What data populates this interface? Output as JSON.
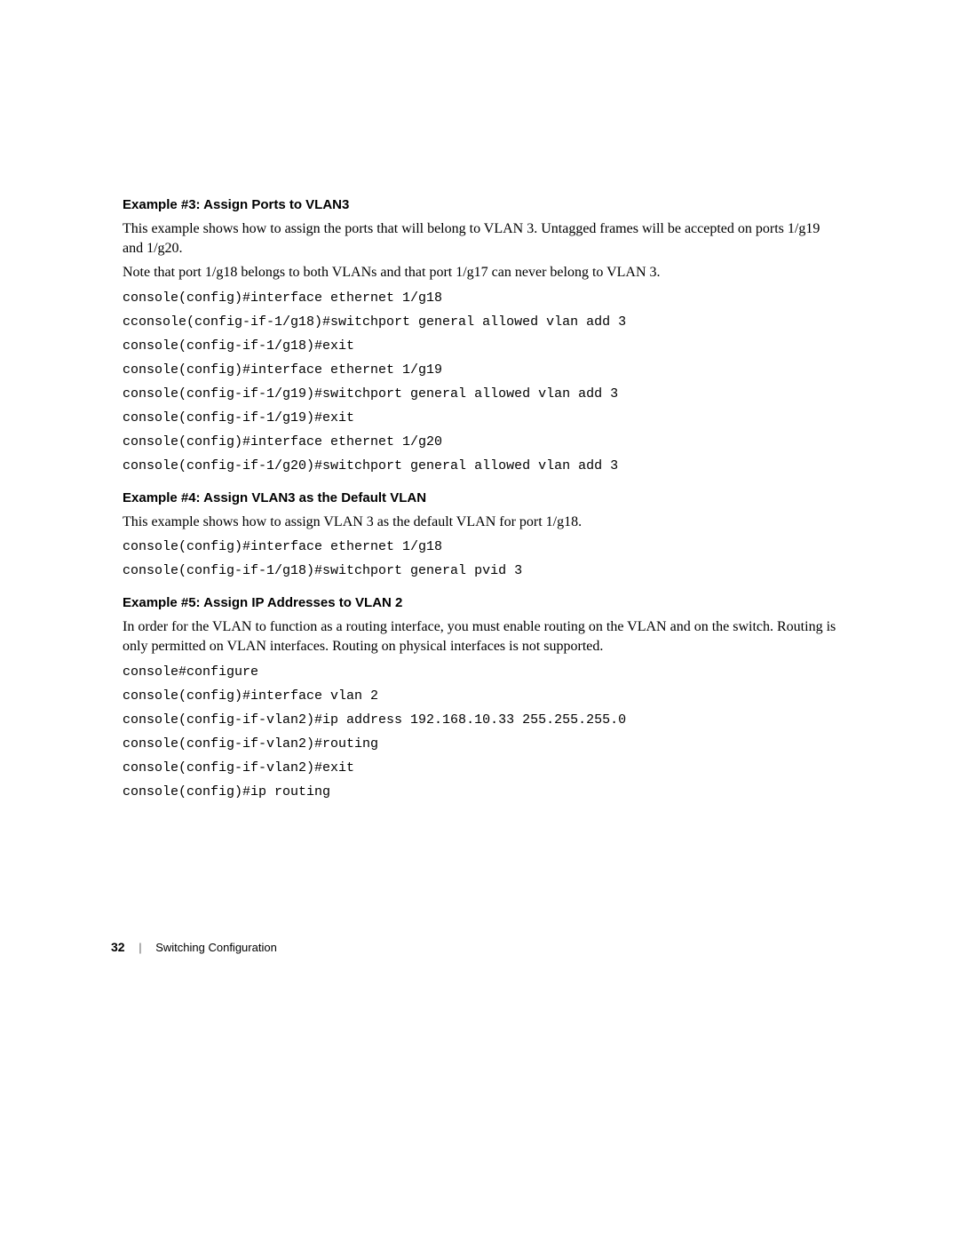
{
  "section1": {
    "heading": "Example #3: Assign Ports to VLAN3",
    "para1": "This example shows how to assign the ports that will belong to VLAN 3. Untagged frames will be accepted on ports 1/g19 and 1/g20.",
    "para2": "Note that port 1/g18 belongs to both VLANs and that port 1/g17 can never belong to VLAN 3.",
    "code": [
      "console(config)#interface ethernet 1/g18",
      "cconsole(config-if-1/g18)#switchport general allowed vlan add 3",
      "console(config-if-1/g18)#exit",
      "console(config)#interface ethernet 1/g19",
      "console(config-if-1/g19)#switchport general allowed vlan add 3",
      "console(config-if-1/g19)#exit",
      "console(config)#interface ethernet 1/g20",
      "console(config-if-1/g20)#switchport general allowed vlan add 3"
    ]
  },
  "section2": {
    "heading": "Example #4: Assign VLAN3 as the Default VLAN",
    "para1": "This example shows how to assign VLAN 3 as the default VLAN for port 1/g18.",
    "code": [
      "console(config)#interface ethernet 1/g18",
      "console(config-if-1/g18)#switchport general pvid 3"
    ]
  },
  "section3": {
    "heading": "Example #5: Assign IP Addresses to VLAN 2",
    "para1": "In order for the VLAN to function as a routing interface, you must enable routing on the VLAN and on the switch. Routing is only permitted on VLAN interfaces. Routing on physical interfaces is not supported.",
    "code": [
      "console#configure",
      "console(config)#interface vlan 2",
      "console(config-if-vlan2)#ip address 192.168.10.33 255.255.255.0",
      "console(config-if-vlan2)#routing",
      "console(config-if-vlan2)#exit",
      "console(config)#ip routing"
    ]
  },
  "footer": {
    "page": "32",
    "sep": "|",
    "title": "Switching Configuration"
  }
}
